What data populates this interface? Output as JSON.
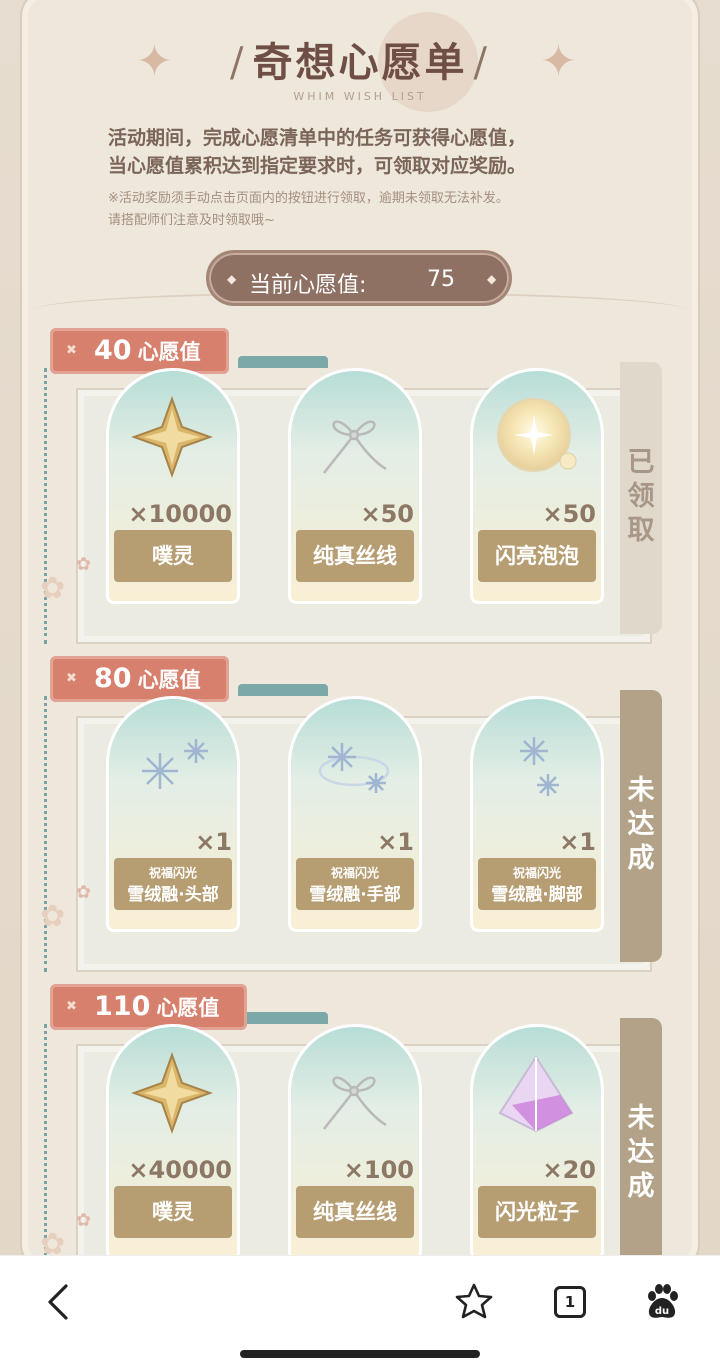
{
  "header": {
    "title": "奇想心愿单",
    "subtitle": "WHIM WISH LIST",
    "desc_line1": "活动期间，完成心愿清单中的任务可获得心愿值，",
    "desc_line2": "当心愿值累积达到指定要求时，可领取对应奖励。",
    "note_line1": "※活动奖励须手动点击页面内的按钮进行领取，逾期未领取无法补发。",
    "note_line2": "请搭配师们注意及时领取哦~"
  },
  "current": {
    "label": "当前心愿值:",
    "value": "75"
  },
  "tiers": [
    {
      "threshold": "40",
      "unit": "心愿值",
      "status": "已领取",
      "items": [
        {
          "qty": "×10000",
          "name": "噗灵",
          "icon": "gold-star-crystal-icon"
        },
        {
          "qty": "×50",
          "name": "纯真丝线",
          "icon": "silk-thread-bow-icon"
        },
        {
          "qty": "×50",
          "name": "闪亮泡泡",
          "icon": "shiny-bubble-icon"
        }
      ]
    },
    {
      "threshold": "80",
      "unit": "心愿值",
      "status": "未达成",
      "items": [
        {
          "qty": "×1",
          "sub": "祝福闪光",
          "name": "雪绒融·头部",
          "icon": "snowflake-head-icon"
        },
        {
          "qty": "×1",
          "sub": "祝福闪光",
          "name": "雪绒融·手部",
          "icon": "snowflake-hand-icon"
        },
        {
          "qty": "×1",
          "sub": "祝福闪光",
          "name": "雪绒融·脚部",
          "icon": "snowflake-foot-icon"
        }
      ]
    },
    {
      "threshold": "110",
      "unit": "心愿值",
      "status": "未达成",
      "items": [
        {
          "qty": "×40000",
          "name": "噗灵",
          "icon": "gold-star-crystal-icon"
        },
        {
          "qty": "×100",
          "name": "纯真丝线",
          "icon": "silk-thread-bow-icon"
        },
        {
          "qty": "×20",
          "name": "闪光粒子",
          "icon": "pyramid-crystal-icon"
        }
      ]
    }
  ],
  "bottom_bar": {
    "tab_count": "1"
  },
  "colors": {
    "tag": "#d7806d",
    "name_plate": "#b79e72",
    "status_pending": "#b3a288",
    "status_done": "#e1d8cc"
  }
}
